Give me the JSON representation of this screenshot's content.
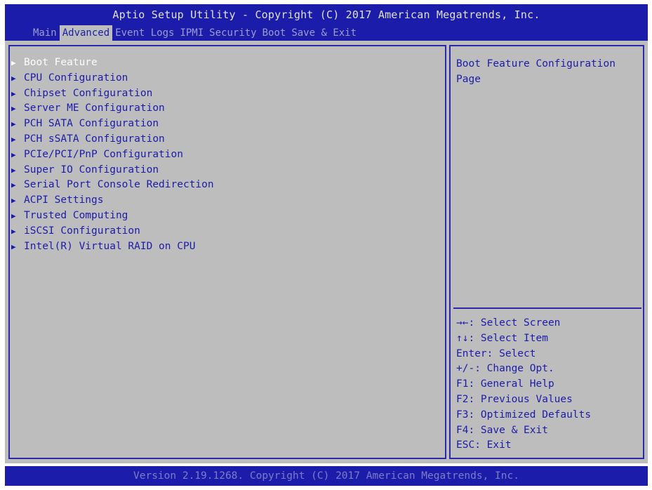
{
  "header": {
    "title": "Aptio Setup Utility - Copyright (C) 2017 American Megatrends, Inc.",
    "tabs": [
      "Main",
      "Advanced",
      "Event Logs",
      "IPMI",
      "Security",
      "Boot",
      "Save & Exit"
    ],
    "active_tab": "Advanced"
  },
  "menu": {
    "selected": "Boot Feature",
    "items": [
      "Boot Feature",
      "CPU Configuration",
      "Chipset Configuration",
      "Server ME Configuration",
      "PCH SATA Configuration",
      "PCH sSATA Configuration",
      "PCIe/PCI/PnP Configuration",
      "Super IO Configuration",
      "Serial Port Console Redirection",
      "ACPI Settings",
      "Trusted Computing",
      "iSCSI Configuration",
      "Intel(R) Virtual RAID on CPU"
    ]
  },
  "help": {
    "text": "Boot Feature Configuration Page",
    "keys": [
      "→←: Select Screen",
      "↑↓: Select Item",
      "Enter: Select",
      "+/-: Change Opt.",
      "F1: General Help",
      "F2: Previous Values",
      "F3: Optimized Defaults",
      "F4: Save & Exit",
      "ESC: Exit"
    ]
  },
  "footer": {
    "text": "Version 2.19.1268. Copyright (C) 2017 American Megatrends, Inc."
  },
  "colors": {
    "blue": "#1c1cab",
    "panel_gray": "#bdbdbd",
    "tab_text": "#9c9cd6",
    "footer_text": "#7c7cc8",
    "title_text": "#e0e0e0"
  }
}
